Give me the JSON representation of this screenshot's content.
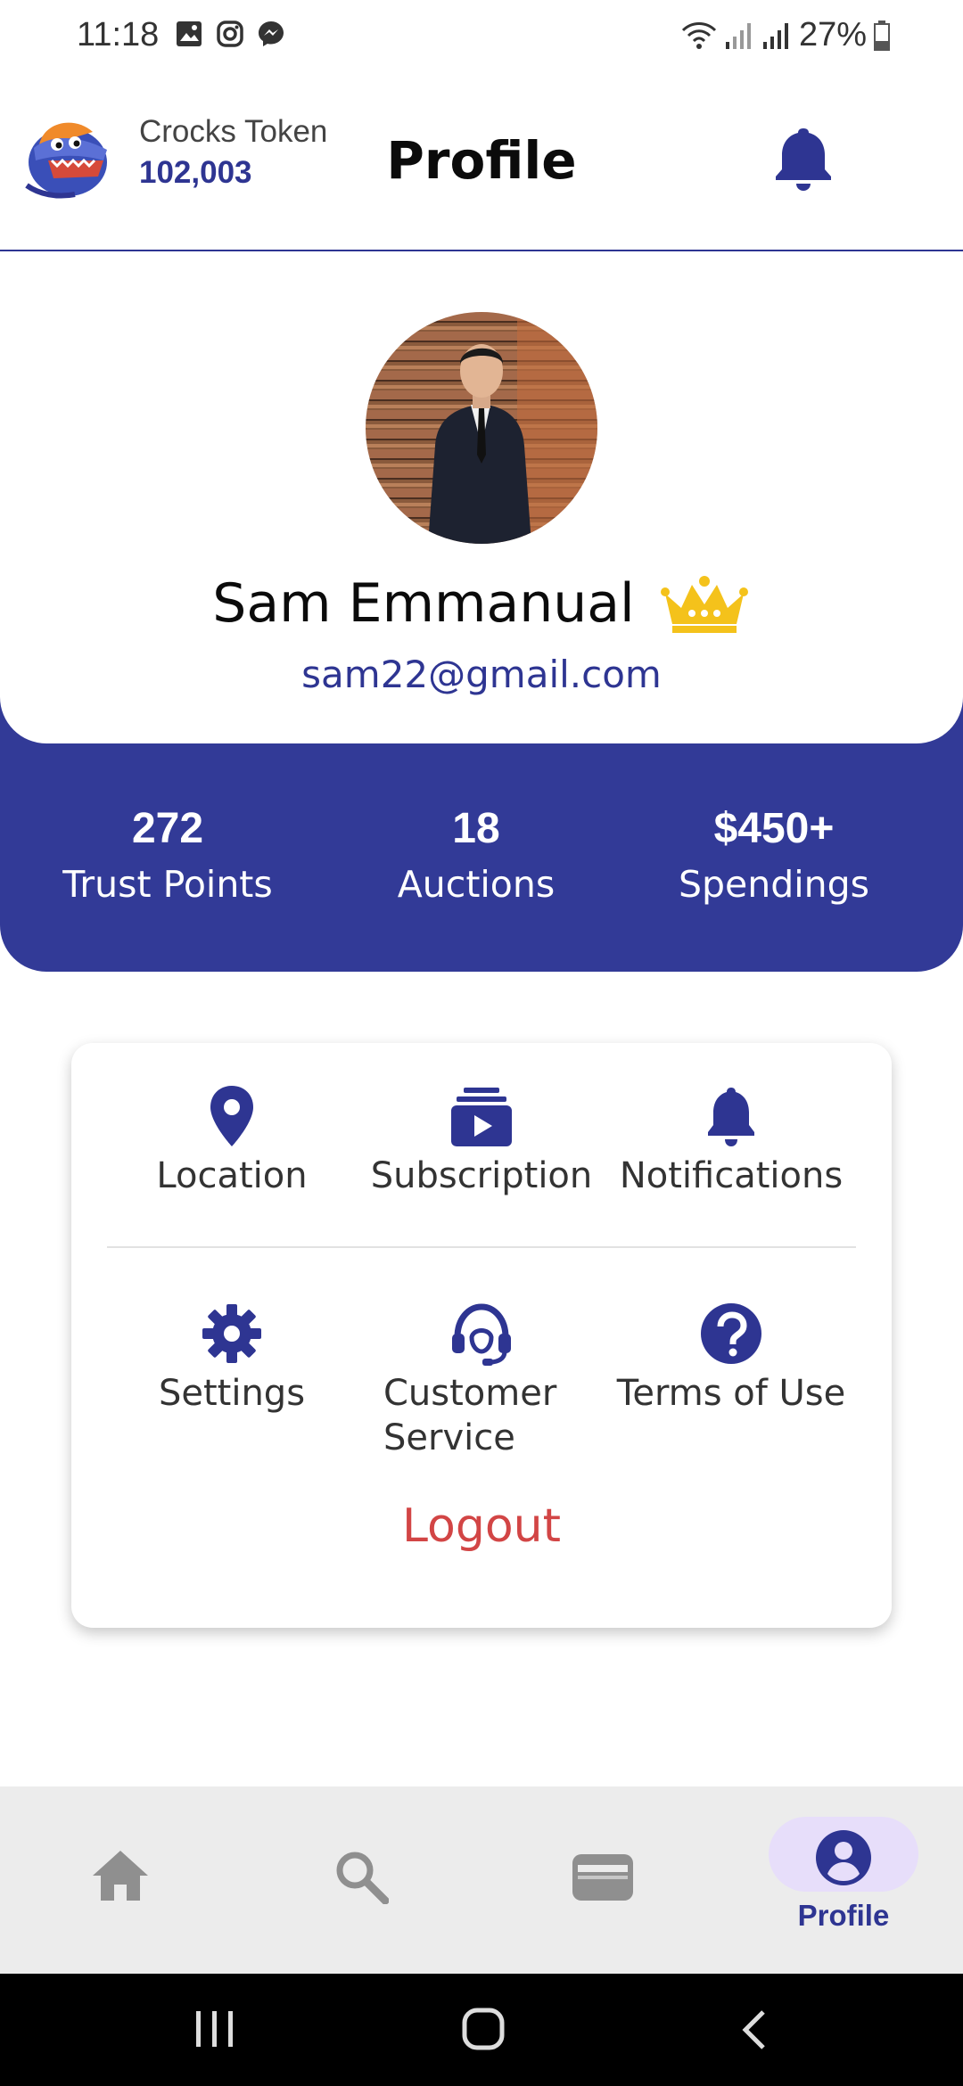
{
  "status_bar": {
    "time": "11:18",
    "battery": "27%"
  },
  "header": {
    "token_label": "Crocks Token",
    "token_value": "102,003",
    "title": "Profile"
  },
  "profile": {
    "name": "Sam Emmanual",
    "email": "sam22@gmail.com"
  },
  "stats": [
    {
      "value": "272",
      "label": "Trust Points"
    },
    {
      "value": "18",
      "label": "Auctions"
    },
    {
      "value": "$450+",
      "label": "Spendings"
    }
  ],
  "menu": {
    "row1": [
      {
        "label": "Location",
        "icon": "location-pin-icon"
      },
      {
        "label": "Subscription",
        "icon": "subscription-icon"
      },
      {
        "label": "Notifications",
        "icon": "bell-icon"
      }
    ],
    "row2": [
      {
        "label": "Settings",
        "icon": "gear-icon"
      },
      {
        "label": "Customer\nService",
        "icon": "headset-icon"
      },
      {
        "label": "Terms of Use",
        "icon": "question-icon"
      }
    ],
    "logout": "Logout"
  },
  "bottom_nav": {
    "items": [
      "home-icon",
      "search-icon",
      "wallet-icon",
      "profile-icon"
    ],
    "active_label": "Profile"
  },
  "colors": {
    "brand": "#323a97",
    "logout": "#d24545",
    "active_pill": "#e7defa"
  }
}
